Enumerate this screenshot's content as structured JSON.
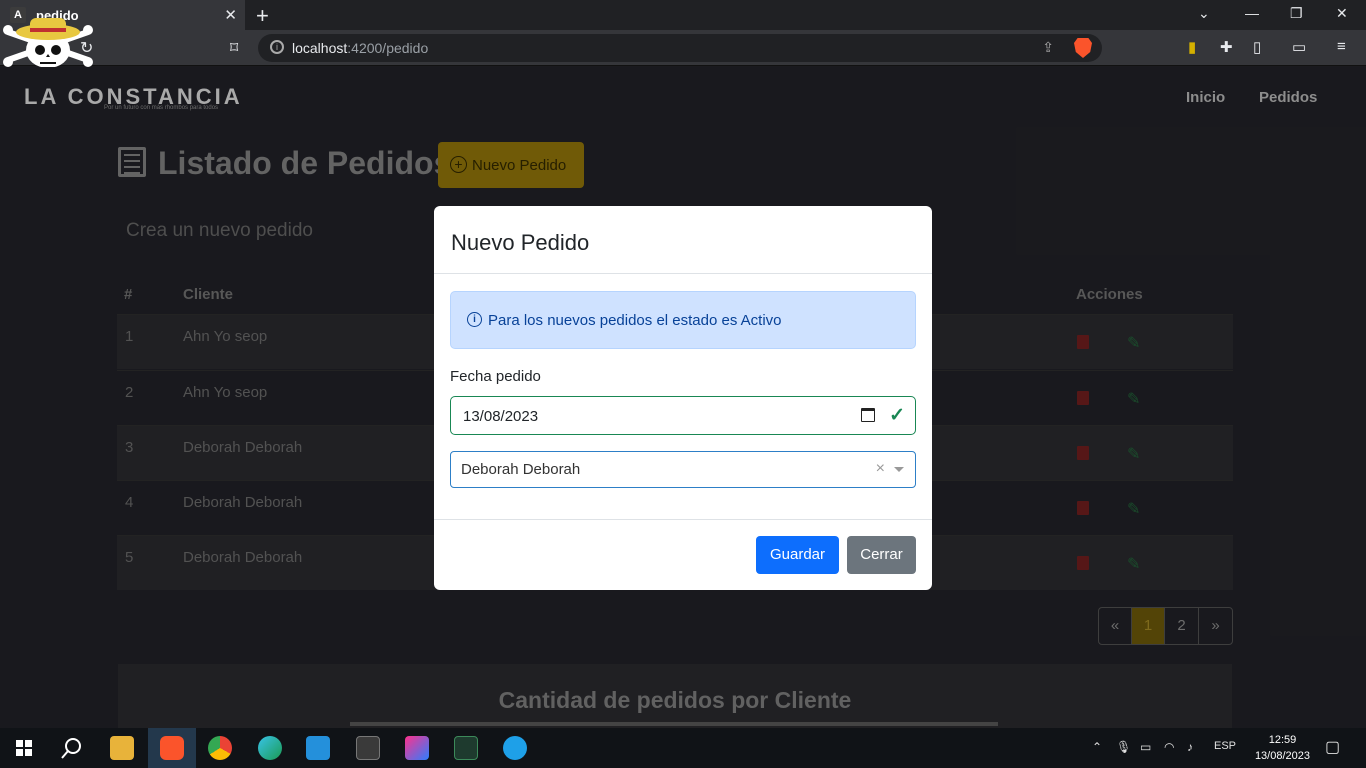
{
  "browser": {
    "tab_title": "pedido",
    "tab_favicon": "A",
    "url_host": "localhost",
    "url_path": ":4200/pedido"
  },
  "nav": {
    "brand": "LA CONSTANCIA",
    "brand_sub": "Por un futuro con más rhombos para todos",
    "links": [
      "Inicio",
      "Pedidos"
    ]
  },
  "header": {
    "title": "Listado de Pedidos",
    "new_button": "Nuevo Pedido",
    "subtitle": "Crea un nuevo pedido"
  },
  "table": {
    "columns": [
      "#",
      "Cliente",
      "Acciones"
    ],
    "rows": [
      {
        "num": "1",
        "cliente": "Ahn Yo seop"
      },
      {
        "num": "2",
        "cliente": "Ahn Yo seop"
      },
      {
        "num": "3",
        "cliente": "Deborah Deborah"
      },
      {
        "num": "4",
        "cliente": "Deborah Deborah"
      },
      {
        "num": "5",
        "cliente": "Deborah Deborah"
      }
    ]
  },
  "pagination": {
    "prev": "«",
    "pages": [
      "1",
      "2"
    ],
    "current": "1",
    "next": "»"
  },
  "chart_section": {
    "title": "Cantidad de pedidos por Cliente"
  },
  "modal": {
    "title": "Nuevo Pedido",
    "alert": "Para los nuevos pedidos el estado es Activo",
    "date_label": "Fecha pedido",
    "date_value": "13/08/2023",
    "client_value": "Deborah Deborah",
    "save": "Guardar",
    "close": "Cerrar"
  },
  "taskbar": {
    "lang": "ESP",
    "time": "12:59",
    "date": "13/08/2023"
  },
  "colors": {
    "accent": "#0d6efd",
    "brand_gold": "#7a6208",
    "success": "#198754"
  }
}
